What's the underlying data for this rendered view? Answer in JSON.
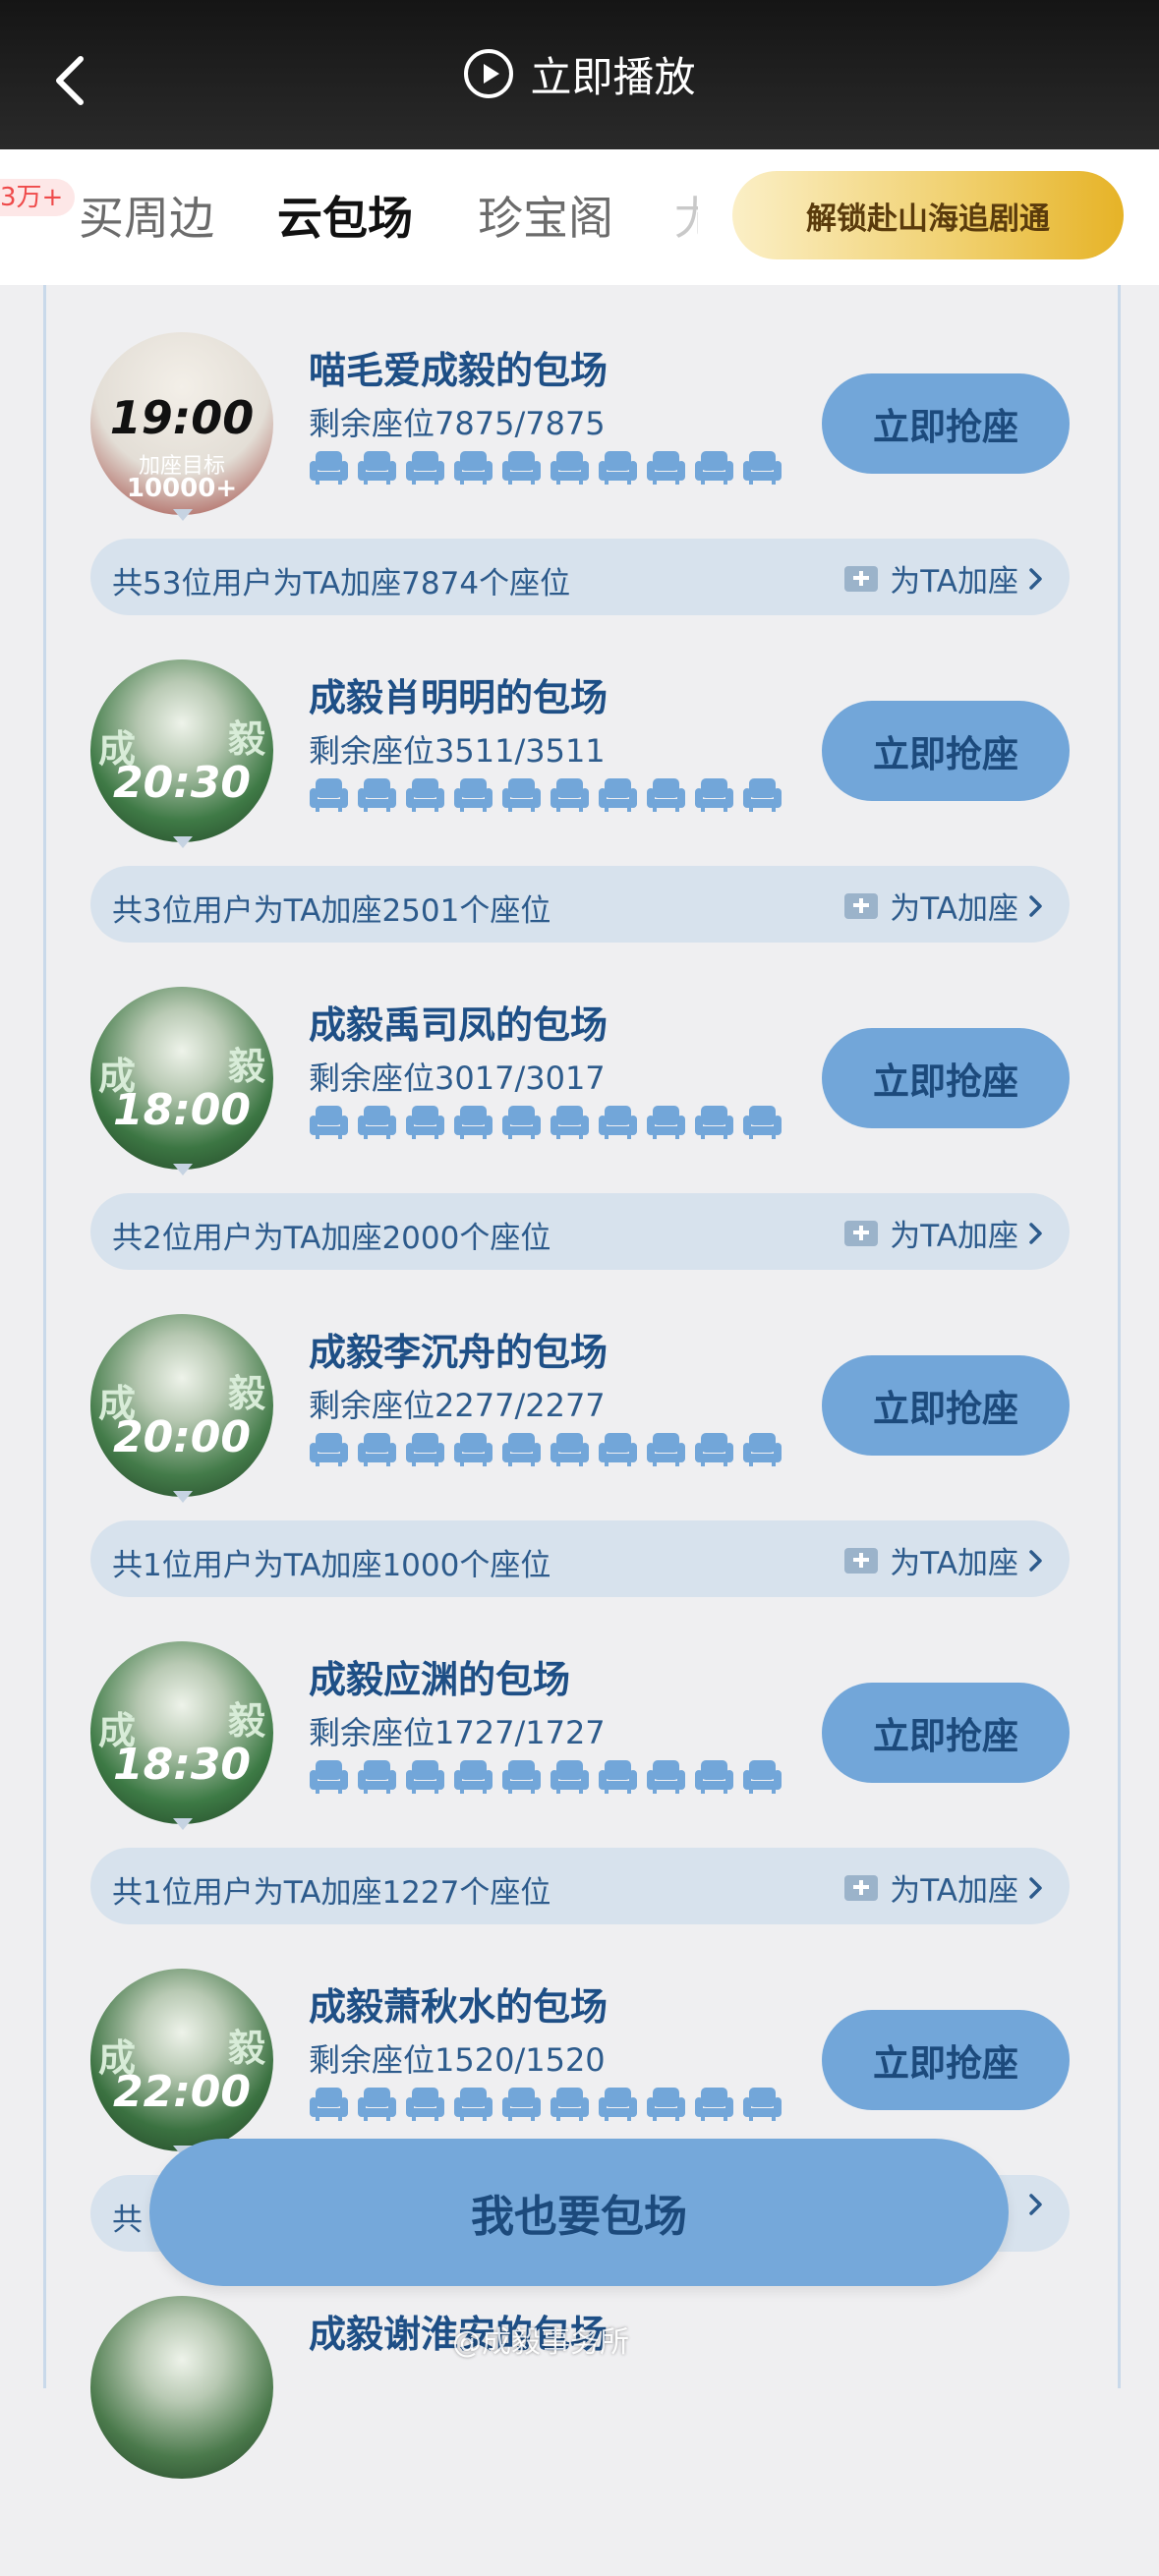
{
  "header": {
    "title": "立即播放"
  },
  "tabs": {
    "badge": "3万+",
    "items": [
      {
        "label": "买周边",
        "active": false
      },
      {
        "label": "云包场",
        "active": true
      },
      {
        "label": "珍宝阁",
        "active": false
      }
    ],
    "cut_label": "尤",
    "unlock_label": "解锁赴山海追剧通"
  },
  "colors": {
    "accent": "#72a6d9",
    "title": "#1e4f86",
    "strip": "#d7e2ed",
    "gold": "#e6b327"
  },
  "cards": [
    {
      "title": "喵毛爱成毅的包场",
      "seats": "剩余座位7875/7875",
      "grab_label": "立即抢座",
      "strip": "共53位用户为TA加座7874个座位",
      "add_label": "为TA加座",
      "avatar_time": "19:00",
      "avatar_note": "加座目标",
      "avatar_goal": "10000+",
      "avatar_bg": "#c85a55"
    },
    {
      "title": "成毅肖明明的包场",
      "seats": "剩余座位3511/3511",
      "grab_label": "立即抢座",
      "strip": "共3位用户为TA加座2501个座位",
      "add_label": "为TA加座",
      "avatar_time": "20:30",
      "avatar_bg": "#3f7a46"
    },
    {
      "title": "成毅禹司凤的包场",
      "seats": "剩余座位3017/3017",
      "grab_label": "立即抢座",
      "strip": "共2位用户为TA加座2000个座位",
      "add_label": "为TA加座",
      "avatar_time": "18:00",
      "avatar_bg": "#3c7643"
    },
    {
      "title": "成毅李沉舟的包场",
      "seats": "剩余座位2277/2277",
      "grab_label": "立即抢座",
      "strip": "共1位用户为TA加座1000个座位",
      "add_label": "为TA加座",
      "avatar_time": "20:00",
      "avatar_bg": "#447c4a"
    },
    {
      "title": "成毅应渊的包场",
      "seats": "剩余座位1727/1727",
      "grab_label": "立即抢座",
      "strip": "共1位用户为TA加座1227个座位",
      "add_label": "为TA加座",
      "avatar_time": "18:30",
      "avatar_bg": "#3d7a45"
    },
    {
      "title": "成毅萧秋水的包场",
      "seats": "剩余座位1520/1520",
      "grab_label": "立即抢座",
      "strip": "共",
      "add_label": "",
      "avatar_time": "22:00",
      "avatar_bg": "#3b7241"
    },
    {
      "title": "成毅谢淮安的包场",
      "seats": "",
      "grab_label": "",
      "strip": "",
      "add_label": "",
      "avatar_time": "",
      "avatar_bg": "#4b7a4c"
    }
  ],
  "floating_button": "我也要包场",
  "watermark": "@成毅事务所"
}
